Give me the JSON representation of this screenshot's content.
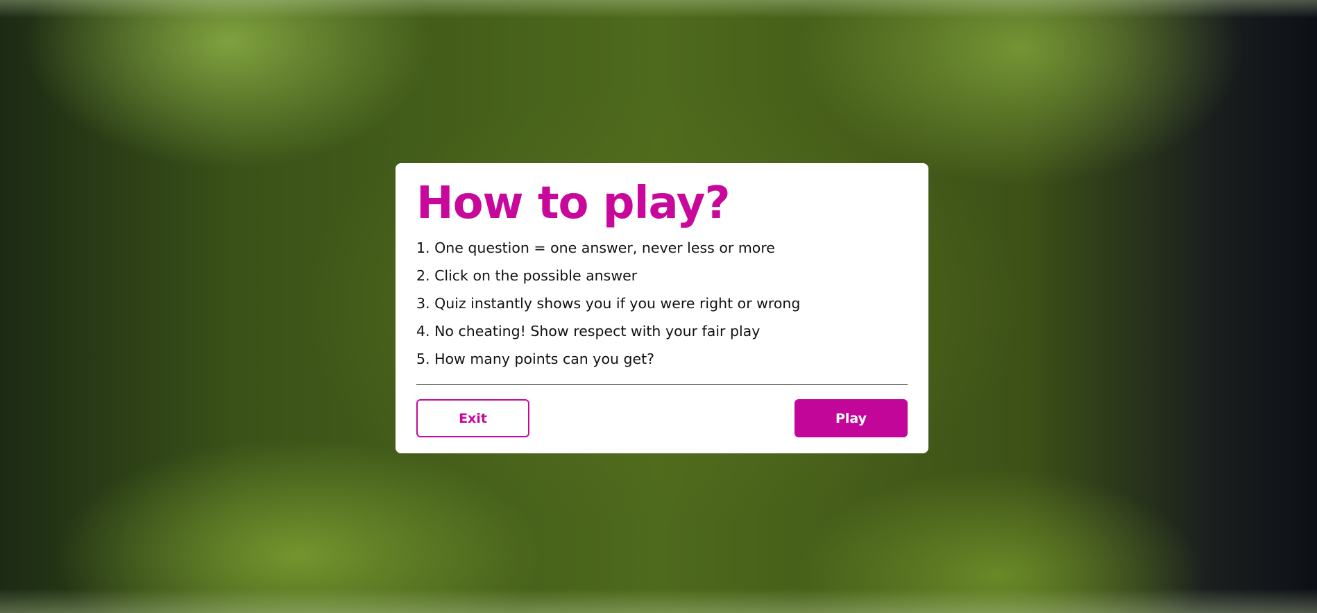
{
  "modal": {
    "title": "How to play?",
    "rules": [
      "1. One question = one answer, never less or more",
      "2. Click on the possible answer",
      "3. Quiz instantly shows you if you were right or wrong",
      "4. No cheating! Show respect with your fair play",
      "5. How many points can you get?"
    ],
    "exit_label": "Exit",
    "play_label": "Play"
  },
  "colors": {
    "accent": "#c8079b",
    "text": "#111111",
    "background_tint": "#4e6a1c"
  }
}
